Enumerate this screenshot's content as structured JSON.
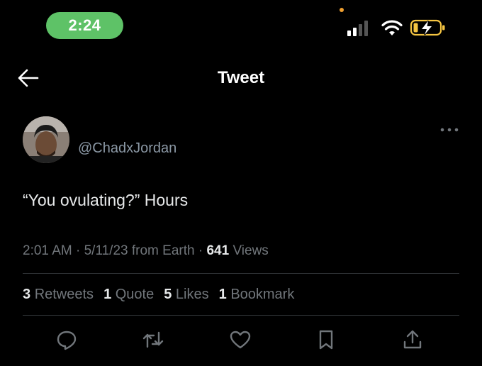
{
  "status_bar": {
    "time": "2:24",
    "icons": [
      "signal-icon",
      "wifi-icon",
      "battery-charging-icon"
    ],
    "pill_color": "#5ec267"
  },
  "header": {
    "title": "Tweet",
    "back_icon": "arrow-left-icon"
  },
  "tweet": {
    "handle": "@ChadxJordan",
    "text": "“You ovulating?” Hours",
    "time": "2:01 AM",
    "date": "5/11/23",
    "source": "from Earth",
    "views_count": "641",
    "views_label": "Views"
  },
  "stats": {
    "retweets_count": "3",
    "retweets_label": "Retweets",
    "quotes_count": "1",
    "quotes_label": "Quote",
    "likes_count": "5",
    "likes_label": "Likes",
    "bookmarks_count": "1",
    "bookmarks_label": "Bookmark"
  },
  "actions": [
    "reply-icon",
    "retweet-icon",
    "like-icon",
    "bookmark-icon",
    "share-icon"
  ],
  "colors": {
    "background": "#000000",
    "muted_text": "#71767b",
    "handle_text": "#8b98a5",
    "divider": "#2f3336"
  }
}
